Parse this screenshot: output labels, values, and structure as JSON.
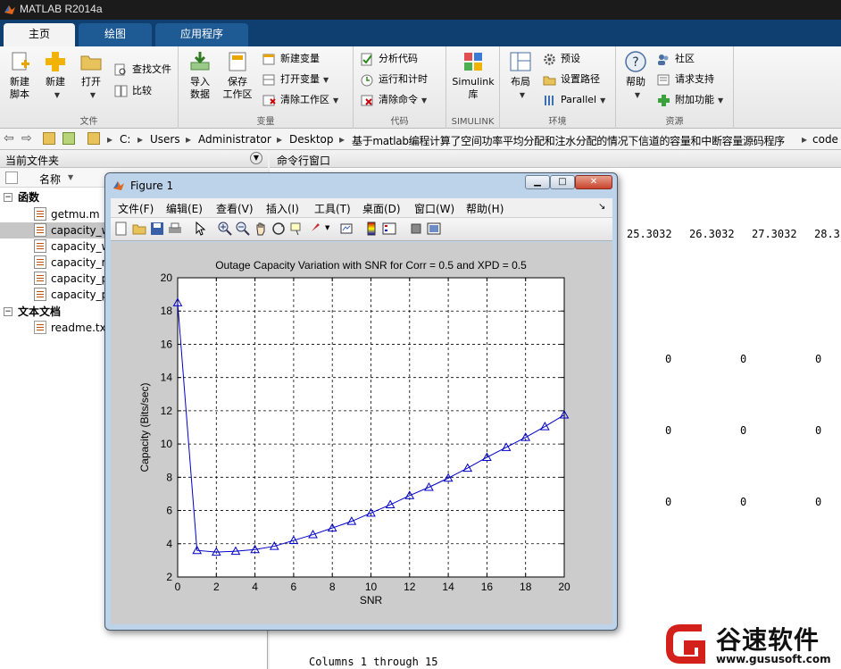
{
  "app": {
    "title": "MATLAB R2014a"
  },
  "tabs": [
    {
      "label": "主页",
      "active": true
    },
    {
      "label": "绘图",
      "active": false
    },
    {
      "label": "应用程序",
      "active": false
    }
  ],
  "ribbon": {
    "file": {
      "label": "文件",
      "new_script": [
        "新建",
        "脚本"
      ],
      "new": "新建",
      "open": "打开",
      "find_files": "查找文件",
      "compare": "比较"
    },
    "variable": {
      "label": "变量",
      "import": [
        "导入",
        "数据"
      ],
      "save_ws": [
        "保存",
        "工作区"
      ],
      "new_var": "新建变量",
      "open_var": "打开变量",
      "clear_ws": "清除工作区"
    },
    "code": {
      "label": "代码",
      "analyze": "分析代码",
      "run_time": "运行和计时",
      "clear_cmd": "清除命令"
    },
    "simulink": {
      "label": "SIMULINK",
      "lib": [
        "Simulink",
        "库"
      ]
    },
    "environment": {
      "label": "环境",
      "layout": "布局",
      "prefs": "预设",
      "set_path": "设置路径",
      "parallel": "Parallel"
    },
    "resources": {
      "label": "资源",
      "help": "帮助",
      "community": "社区",
      "support": "请求支持",
      "addons": "附加功能"
    }
  },
  "address": {
    "crumbs": [
      "C:",
      "Users",
      "Administrator",
      "Desktop",
      "基于matlab编程计算了空间功率平均分配和注水分配的情况下信道的容量和中断容量源码程序",
      "code"
    ]
  },
  "left_panel": {
    "title": "当前文件夹",
    "col_name": "名称",
    "group_functions": "函数",
    "files": [
      "getmu.m",
      "capacity_w",
      "capacity_w",
      "capacity_ri",
      "capacity_p",
      "capacity_p"
    ],
    "group_text": "文本文档",
    "text_files": [
      "readme.txt"
    ]
  },
  "command_window": {
    "title": "命令行窗口",
    "row1": [
      "25.3032",
      "26.3032",
      "27.3032",
      "28.3"
    ],
    "zeros": [
      "0",
      "0",
      "0"
    ],
    "footer": "Columns 1 through 15"
  },
  "figure": {
    "title": "Figure 1",
    "menus": [
      "文件(F)",
      "编辑(E)",
      "查看(V)",
      "插入(I)",
      "工具(T)",
      "桌面(D)",
      "窗口(W)",
      "帮助(H)"
    ]
  },
  "chart_data": {
    "type": "line",
    "title": "Outage Capacity Variation with SNR for Corr = 0.5 and XPD = 0.5",
    "xlabel": "SNR",
    "ylabel": "Capacity (Bits/sec)",
    "xlim": [
      0,
      20
    ],
    "ylim": [
      2,
      20
    ],
    "xticks": [
      0,
      2,
      4,
      6,
      8,
      10,
      12,
      14,
      16,
      18,
      20
    ],
    "yticks": [
      2,
      4,
      6,
      8,
      10,
      12,
      14,
      16,
      18,
      20
    ],
    "grid": true,
    "series": [
      {
        "color": "#0000c8",
        "marker": "triangle",
        "x": [
          0,
          1,
          2,
          3,
          4,
          5,
          6,
          7,
          8,
          9,
          10,
          11,
          12,
          13,
          14,
          15,
          16,
          17,
          18,
          19,
          20
        ],
        "y": [
          18.5,
          3.6,
          3.5,
          3.55,
          3.65,
          3.85,
          4.2,
          4.55,
          4.95,
          5.35,
          5.85,
          6.35,
          6.9,
          7.4,
          7.95,
          8.55,
          9.2,
          9.8,
          10.4,
          11.05,
          11.75
        ]
      }
    ]
  },
  "watermark": {
    "brand": "谷速软件",
    "url": "www.gususoft.com"
  }
}
